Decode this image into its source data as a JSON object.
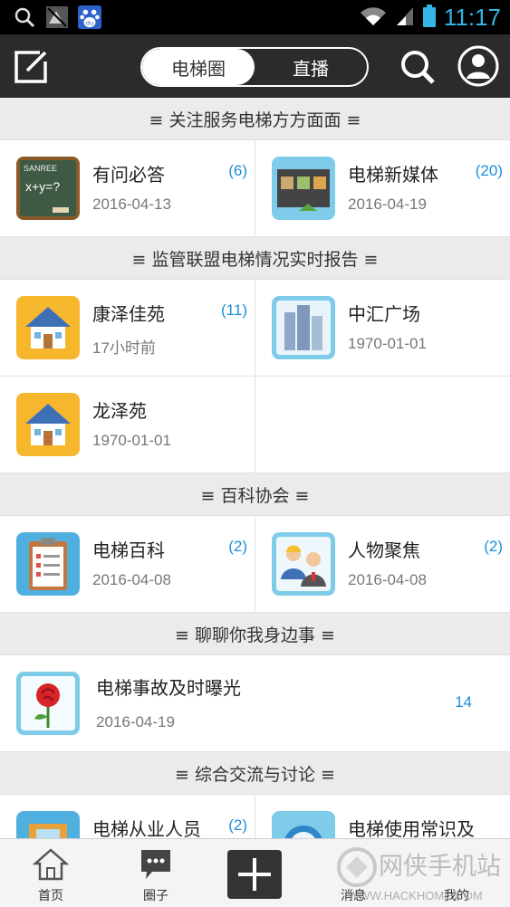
{
  "status_bar": {
    "time": "11:17",
    "icons": [
      "search-icon",
      "silent-icon",
      "baidu-icon",
      "wifi-icon",
      "signal-icon",
      "battery-icon"
    ],
    "baidu_text": "du"
  },
  "top_bar": {
    "tabs": [
      {
        "label": "电梯圈",
        "active": true
      },
      {
        "label": "直播",
        "active": false
      }
    ],
    "icons": [
      "compose-icon",
      "search-icon",
      "user-icon"
    ]
  },
  "sections": [
    {
      "title": "≡ 关注服务电梯方方面面 ≡",
      "items": [
        {
          "title": "有问必答",
          "date": "2016-04-13",
          "count": "(6)",
          "icon": "blackboard-icon",
          "board_text": "x+y=?",
          "board_brand": "SANREE"
        },
        {
          "title": "电梯新媒体",
          "date": "2016-04-19",
          "count": "(20)",
          "icon": "media-icon"
        }
      ]
    },
    {
      "title": "≡ 监管联盟电梯情况实时报告 ≡",
      "items": [
        {
          "title": "康泽佳苑",
          "date": "17小时前",
          "count": "(11)",
          "icon": "house-icon"
        },
        {
          "title": "中汇广场",
          "date": "1970-01-01",
          "count": "",
          "icon": "building-icon"
        },
        {
          "title": "龙泽苑",
          "date": "1970-01-01",
          "count": "",
          "icon": "house-icon"
        }
      ]
    },
    {
      "title": "≡ 百科协会 ≡",
      "items": [
        {
          "title": "电梯百科",
          "date": "2016-04-08",
          "count": "(2)",
          "icon": "clipboard-icon"
        },
        {
          "title": "人物聚焦",
          "date": "2016-04-08",
          "count": "(2)",
          "icon": "people-icon"
        }
      ]
    },
    {
      "title": "≡ 聊聊你我身边事 ≡",
      "items": [
        {
          "title": "电梯事故及时曝光",
          "date": "2016-04-19",
          "count": "14",
          "icon": "rose-icon"
        }
      ]
    },
    {
      "title": "≡ 综合交流与讨论 ≡",
      "items": [
        {
          "title": "电梯从业人员",
          "date": "",
          "count": "(2)",
          "icon": "worker-icon"
        },
        {
          "title": "电梯使用常识及",
          "date": "",
          "count": "",
          "icon": "globe-icon"
        }
      ]
    }
  ],
  "bottom_nav": {
    "items": [
      {
        "label": "首页",
        "icon": "home-icon"
      },
      {
        "label": "圈子",
        "icon": "chat-icon"
      },
      {
        "label": "",
        "icon": "add-icon"
      },
      {
        "label": "消息",
        "icon": "message-icon"
      },
      {
        "label": "我的",
        "icon": "me-icon"
      }
    ]
  },
  "watermark": {
    "name": "网侠手机站",
    "url": "WWW.HACKHOME.COM"
  },
  "colors": {
    "accent_blue": "#1a8fd8",
    "top_bar": "#2b2b2b",
    "section_bg": "#ebebeb",
    "status_time": "#33b5e5"
  }
}
